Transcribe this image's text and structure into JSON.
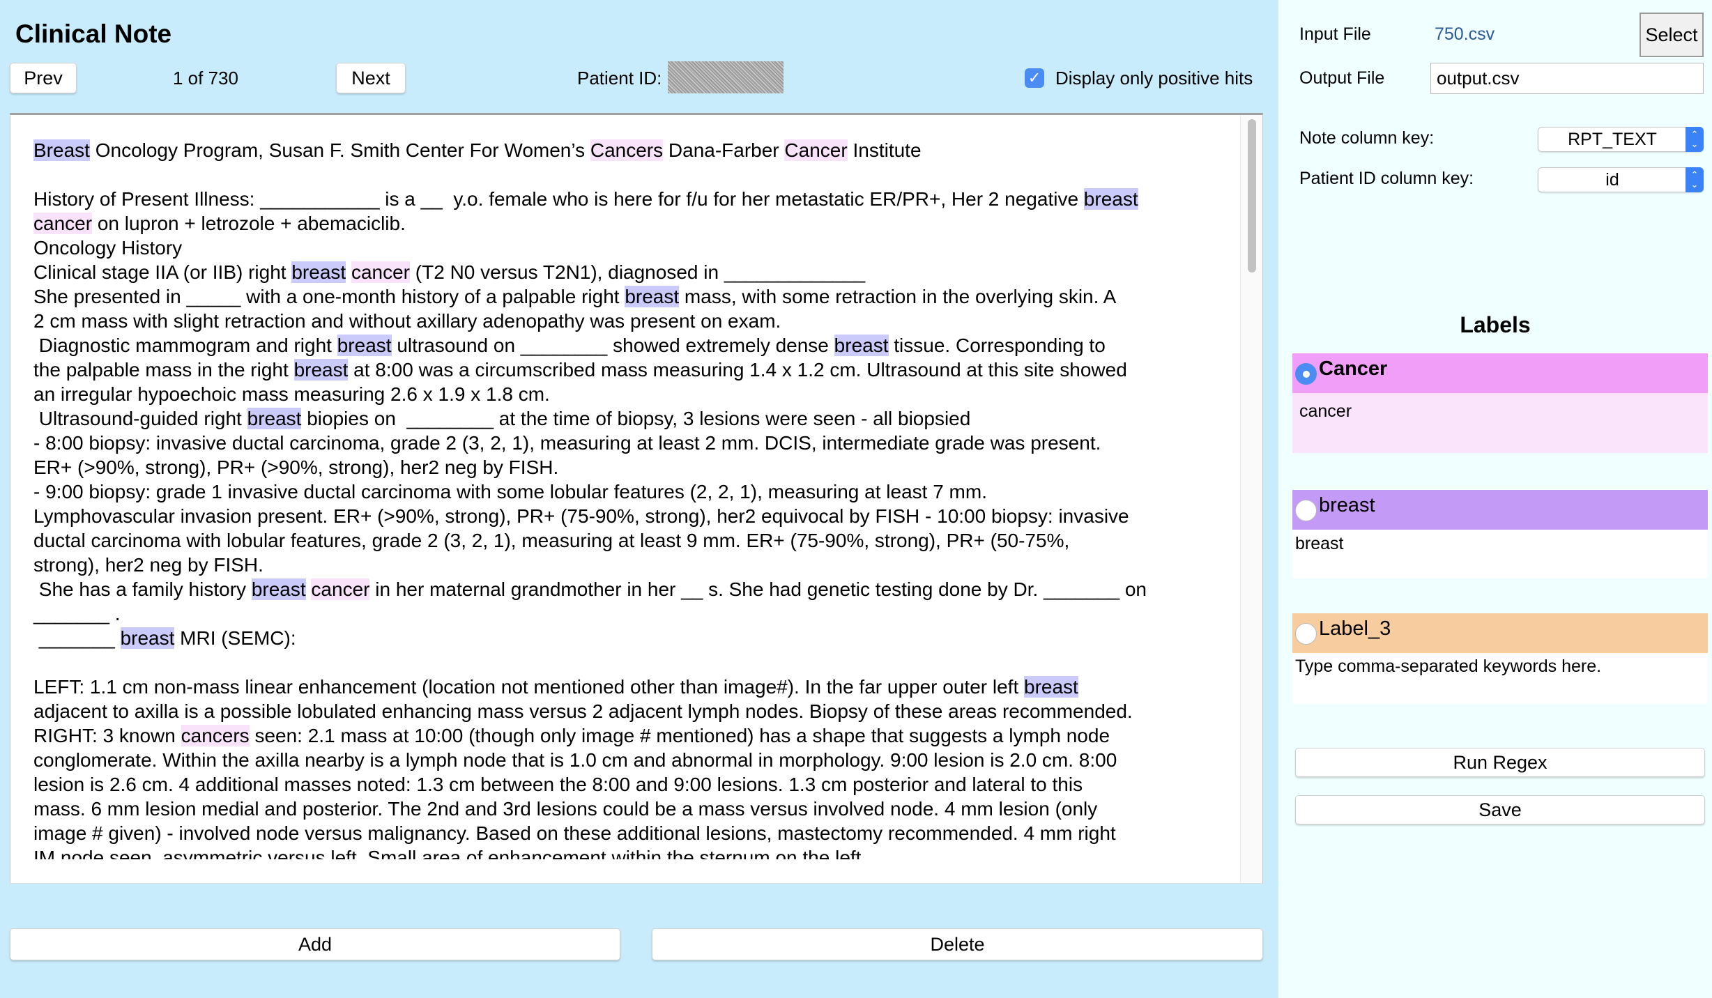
{
  "header": {
    "title": "Clinical Note",
    "prev_label": "Prev",
    "next_label": "Next",
    "position": "1 of 730",
    "patient_id_label": "Patient ID:",
    "positive_hits_label": "Display only positive hits",
    "positive_hits_checked": true
  },
  "highlight_colors": {
    "breast": "#cacafb",
    "cancer": "#f9e3fb"
  },
  "note": {
    "lines": [
      [
        [
          "Breast",
          "b"
        ],
        [
          " Oncology Program, Susan F. Smith Center For Women’s ",
          ""
        ],
        [
          "Cancers",
          "c"
        ],
        [
          " Dana-Farber ",
          ""
        ],
        [
          "Cancer",
          "c"
        ],
        [
          " Institute",
          ""
        ]
      ],
      [],
      [
        [
          "History of Present Illness: ___________ is a __  y.o. female who is here for f/u for her metastatic ER/PR+, Her 2 negative ",
          ""
        ],
        [
          "breast",
          "b"
        ]
      ],
      [
        [
          "cancer",
          "c"
        ],
        [
          " on lupron + letrozole + abemaciclib.",
          ""
        ]
      ],
      [
        [
          "Oncology History",
          ""
        ]
      ],
      [
        [
          "Clinical stage IIA (or IIB) right ",
          ""
        ],
        [
          "breast",
          "b"
        ],
        [
          " ",
          ""
        ],
        [
          "cancer",
          "c"
        ],
        [
          " (T2 N0 versus T2N1), diagnosed in _____________",
          ""
        ]
      ],
      [
        [
          "She presented in _____ with a one-month history of a palpable right ",
          ""
        ],
        [
          "breast",
          "b"
        ],
        [
          " mass, with some retraction in the overlying skin. A",
          ""
        ]
      ],
      [
        [
          "2 cm mass with slight retraction and without axillary adenopathy was present on exam.",
          ""
        ]
      ],
      [
        [
          " Diagnostic mammogram and right ",
          ""
        ],
        [
          "breast",
          "b"
        ],
        [
          " ultrasound on ________ showed extremely dense ",
          ""
        ],
        [
          "breast",
          "b"
        ],
        [
          " tissue. Corresponding to",
          ""
        ]
      ],
      [
        [
          "the palpable mass in the right ",
          ""
        ],
        [
          "breast",
          "b"
        ],
        [
          " at 8:00 was a circumscribed mass measuring 1.4 x 1.2 cm. Ultrasound at this site showed",
          ""
        ]
      ],
      [
        [
          "an irregular hypoechoic mass measuring 2.6 x 1.9 x 1.8 cm.",
          ""
        ]
      ],
      [
        [
          " Ultrasound-guided right ",
          ""
        ],
        [
          "breast",
          "b"
        ],
        [
          " biopies on  ________ at the time of biopsy, 3 lesions were seen - all biopsied",
          ""
        ]
      ],
      [
        [
          "- 8:00 biopsy: invasive ductal carcinoma, grade 2 (3, 2, 1), measuring at least 2 mm. DCIS, intermediate grade was present.",
          ""
        ]
      ],
      [
        [
          "ER+ (>90%, strong), PR+ (>90%, strong), her2 neg by FISH.",
          ""
        ]
      ],
      [
        [
          "- 9:00 biopsy: grade 1 invasive ductal carcinoma with some lobular features (2, 2, 1), measuring at least 7 mm.",
          ""
        ]
      ],
      [
        [
          "Lymphovascular invasion present. ER+ (>90%, strong), PR+ (75-90%, strong), her2 equivocal by FISH - 10:00 biopsy: invasive",
          ""
        ]
      ],
      [
        [
          "ductal carcinoma with lobular features, grade 2 (3, 2, 1), measuring at least 9 mm. ER+ (75-90%, strong), PR+ (50-75%,",
          ""
        ]
      ],
      [
        [
          "strong), her2 neg by FISH.",
          ""
        ]
      ],
      [
        [
          " She has a family history ",
          ""
        ],
        [
          "breast",
          "b"
        ],
        [
          " ",
          ""
        ],
        [
          "cancer",
          "c"
        ],
        [
          " in her maternal grandmother in her __ s. She had genetic testing done by Dr. _______ on",
          ""
        ]
      ],
      [
        [
          "_______ .",
          ""
        ]
      ],
      [
        [
          " _______ ",
          ""
        ],
        [
          "breast",
          "b"
        ],
        [
          " MRI (SEMC):",
          ""
        ]
      ],
      [],
      [
        [
          "LEFT: 1.1 cm non-mass linear enhancement (location not mentioned other than image#). In the far upper outer left ",
          ""
        ],
        [
          "breast",
          "b"
        ]
      ],
      [
        [
          "adjacent to axilla is a possible lobulated enhancing mass versus 2 adjacent lymph nodes. Biopsy of these areas recommended.",
          ""
        ]
      ],
      [
        [
          "RIGHT: 3 known ",
          ""
        ],
        [
          "cancers",
          "c"
        ],
        [
          " seen: 2.1 mass at 10:00 (though only image # mentioned) has a shape that suggests a lymph node",
          ""
        ]
      ],
      [
        [
          "conglomerate. Within the axilla nearby is a lymph node that is 1.0 cm and abnormal in morphology. 9:00 lesion is 2.0 cm. 8:00",
          ""
        ]
      ],
      [
        [
          "lesion is 2.6 cm. 4 additional masses noted: 1.3 cm between the 8:00 and 9:00 lesions. 1.3 cm posterior and lateral to this",
          ""
        ]
      ],
      [
        [
          "mass. 6 mm lesion medial and posterior. The 2nd and 3rd lesions could be a mass versus involved node. 4 mm lesion (only",
          ""
        ]
      ],
      [
        [
          "image # given) - involved node versus malignancy. Based on these additional lesions, mastectomy recommended. 4 mm right",
          ""
        ]
      ],
      [
        [
          "IM node seen, asymmetric versus left. Small area of enhancement within the sternum on the left",
          ""
        ]
      ]
    ]
  },
  "footer": {
    "add_label": "Add",
    "delete_label": "Delete"
  },
  "settings": {
    "input_file_label": "Input File",
    "input_file_value": "750.csv",
    "select_label": "Select",
    "output_file_label": "Output File",
    "output_file_value": "output.csv",
    "note_column_label": "Note column key:",
    "note_column_value": "RPT_TEXT",
    "patient_column_label": "Patient ID column key:",
    "patient_column_value": "id"
  },
  "labels": {
    "title": "Labels",
    "items": [
      {
        "name": "Cancer",
        "keywords": "cancer",
        "selected": true,
        "color": "#f09ef8",
        "body_color": "#f9e4fc"
      },
      {
        "name": "breast",
        "keywords": "breast",
        "selected": false,
        "color": "#c39af5",
        "body_color": "#ffffff"
      },
      {
        "name": "Label_3",
        "keywords": "Type comma-separated keywords here.",
        "selected": false,
        "color": "#f7cc9e",
        "body_color": "#ffffff"
      }
    ],
    "run_regex_label": "Run Regex",
    "save_label": "Save"
  }
}
